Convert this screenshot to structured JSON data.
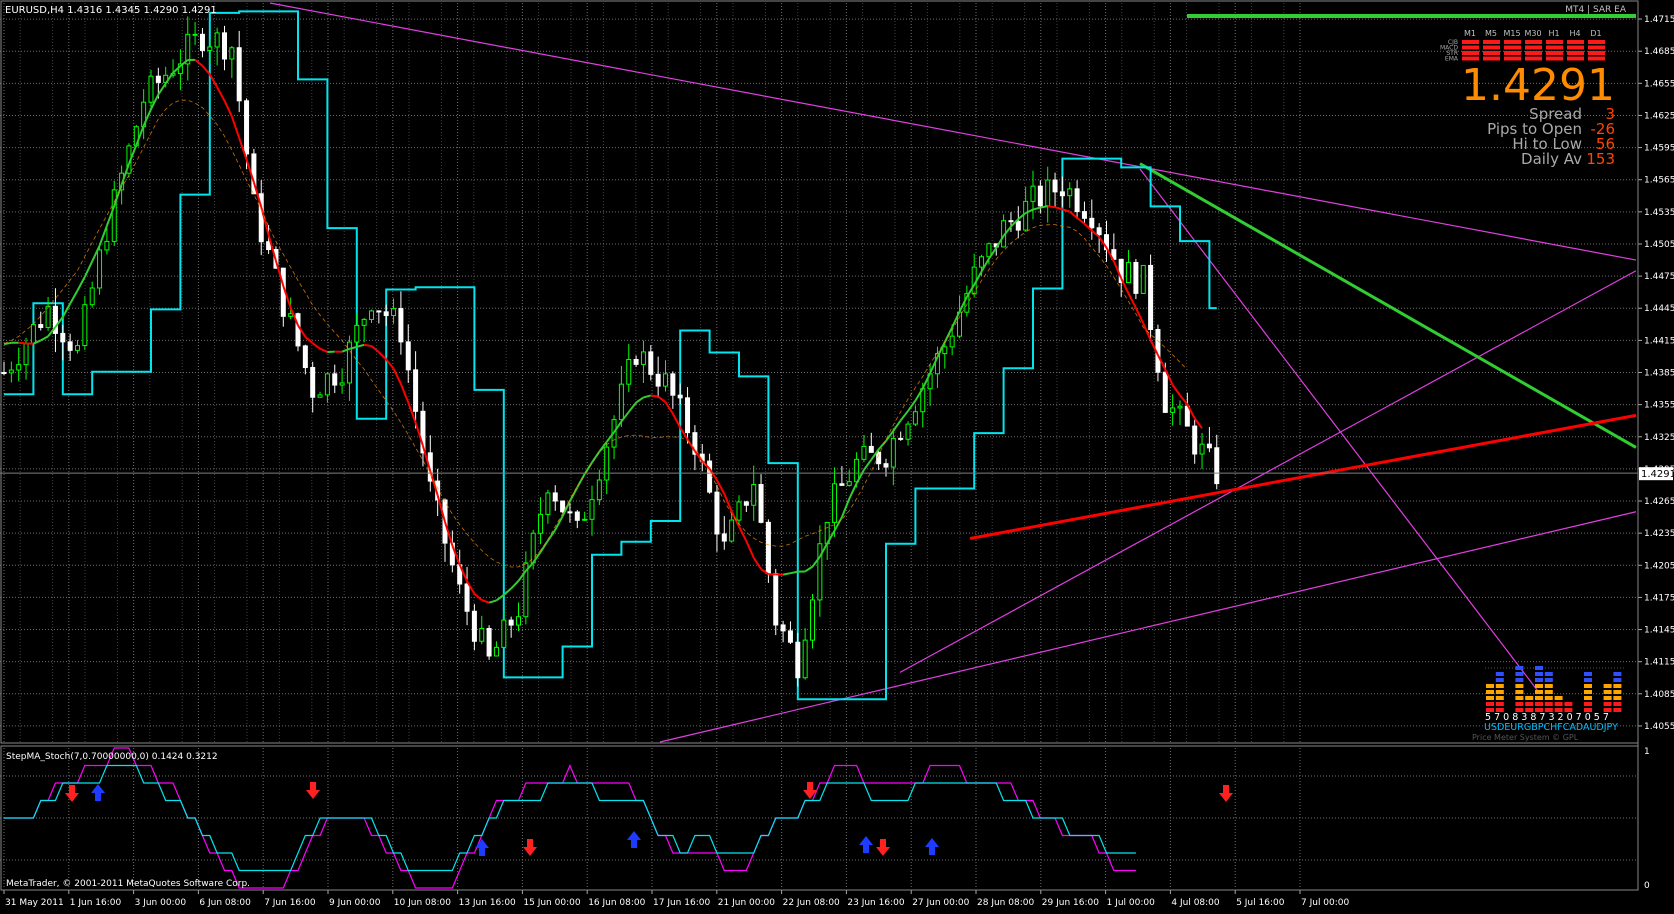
{
  "header": {
    "symbol_info": "EURUSD,H4  1.4316 1.4345 1.4290 1.4291",
    "indicator_label": "MT4 | SAR EA"
  },
  "sub_window": {
    "label": "StepMA_Stoch(7,0.70000000,0) 0.1424 0.3212",
    "copyright": "MetaTrader, © 2001-2011 MetaQuotes Software Corp."
  },
  "dashboard": {
    "timeframes": [
      "M1",
      "M5",
      "M15",
      "M30",
      "H1",
      "H4",
      "D1"
    ],
    "row_labels": [
      "CJB",
      "MACD",
      "STR",
      "EMA"
    ],
    "price": "1.4291",
    "stats": [
      {
        "label": "Spread",
        "value": "3"
      },
      {
        "label": "Pips to Open",
        "value": "-26"
      },
      {
        "label": "Hi to Low",
        "value": "56"
      },
      {
        "label": "Daily Av",
        "value": "153"
      }
    ],
    "price_meter": {
      "numbers": "5 7 0 8 3 8 7 3 2 0 7 0 5 7",
      "currencies": "USDEURGBPCHFCADAUDJPY",
      "caption": "Price Meter System © GPL"
    }
  },
  "colors": {
    "background": "#000000",
    "grid": "#6e6e6e",
    "bull_candle": "#00ff00",
    "bear_candle": "#ffffff",
    "ma_green": "#32cd32",
    "ma_red": "#ff0000",
    "sar_line": "#00e5ee",
    "trendline": "#e040e0",
    "accent_orange": "#ff8c00",
    "stat_label": "#a9a9a9",
    "stat_value": "#ff4500"
  },
  "chart_data": {
    "type": "candlestick",
    "symbol": "EURUSD",
    "timeframe": "H4",
    "y_ticks": [
      "1.4715",
      "1.4685",
      "1.4655",
      "1.4625",
      "1.4595",
      "1.4565",
      "1.4535",
      "1.4505",
      "1.4475",
      "1.4445",
      "1.4415",
      "1.4385",
      "1.4355",
      "1.4325",
      "1.4295",
      "1.4265",
      "1.4235",
      "1.4205",
      "1.4175",
      "1.4145",
      "1.4115",
      "1.4085",
      "1.4055"
    ],
    "ylim": [
      1.404,
      1.473
    ],
    "current_price": "1.4291",
    "current_price_value": 1.4291,
    "x_labels": [
      "31 May 2011",
      "1 Jun 16:00",
      "3 Jun 00:00",
      "6 Jun 08:00",
      "7 Jun 16:00",
      "9 Jun 00:00",
      "10 Jun 08:00",
      "13 Jun 16:00",
      "15 Jun 00:00",
      "16 Jun 08:00",
      "17 Jun 16:00",
      "21 Jun 00:00",
      "22 Jun 08:00",
      "23 Jun 16:00",
      "27 Jun 00:00",
      "28 Jun 08:00",
      "29 Jun 16:00",
      "1 Jul 00:00",
      "4 Jul 08:00",
      "5 Jul 16:00",
      "7 Jul 00:00"
    ],
    "price_path": [
      [
        0,
        1.4385
      ],
      [
        6,
        1.4445
      ],
      [
        10,
        1.4405
      ],
      [
        14,
        1.452
      ],
      [
        19,
        1.464
      ],
      [
        24,
        1.468
      ],
      [
        27,
        1.47
      ],
      [
        31,
        1.469
      ],
      [
        34,
        1.454
      ],
      [
        38,
        1.445
      ],
      [
        42,
        1.437
      ],
      [
        46,
        1.439
      ],
      [
        50,
        1.4455
      ],
      [
        54,
        1.4425
      ],
      [
        58,
        1.4275
      ],
      [
        62,
        1.418
      ],
      [
        66,
        1.4115
      ],
      [
        70,
        1.4165
      ],
      [
        74,
        1.4285
      ],
      [
        78,
        1.4235
      ],
      [
        82,
        1.432
      ],
      [
        86,
        1.4405
      ],
      [
        90,
        1.4375
      ],
      [
        94,
        1.432
      ],
      [
        98,
        1.422
      ],
      [
        102,
        1.4285
      ],
      [
        105,
        1.4155
      ],
      [
        108,
        1.4115
      ],
      [
        112,
        1.4255
      ],
      [
        116,
        1.43
      ],
      [
        120,
        1.431
      ],
      [
        124,
        1.436
      ],
      [
        128,
        1.441
      ],
      [
        132,
        1.4475
      ],
      [
        136,
        1.452
      ],
      [
        140,
        1.4545
      ],
      [
        144,
        1.456
      ],
      [
        148,
        1.4535
      ],
      [
        152,
        1.448
      ],
      [
        155,
        1.447
      ],
      [
        158,
        1.436
      ],
      [
        162,
        1.432
      ],
      [
        165,
        1.4291
      ]
    ],
    "sub_window": {
      "name": "StepMA_Stoch(7,0.70000000,0)",
      "values": [
        0.1424,
        0.3212
      ],
      "ylim": [
        0,
        1
      ]
    }
  }
}
